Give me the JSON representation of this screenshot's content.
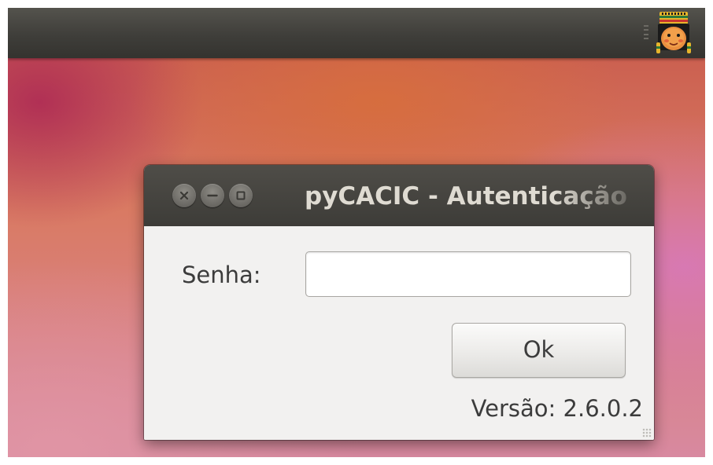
{
  "top_panel": {
    "tray_icon": "pycacic-indian-face-icon",
    "grip_icon": "panel-grip-icon"
  },
  "dialog": {
    "title": "pyCACIC - Autenticação",
    "buttons": {
      "close_icon": "close-icon",
      "minimize_icon": "minimize-icon",
      "maximize_icon": "maximize-icon"
    },
    "password_label": "Senha:",
    "password_value": "",
    "ok_label": "Ok",
    "version_text": "Versão: 2.6.0.2"
  },
  "colors": {
    "panel": "#3f3e3a",
    "titlebar": "#3d3c38",
    "title_text": "#dfdbd2",
    "dialog_bg": "#f2f1f0",
    "text": "#3c3c3c"
  }
}
